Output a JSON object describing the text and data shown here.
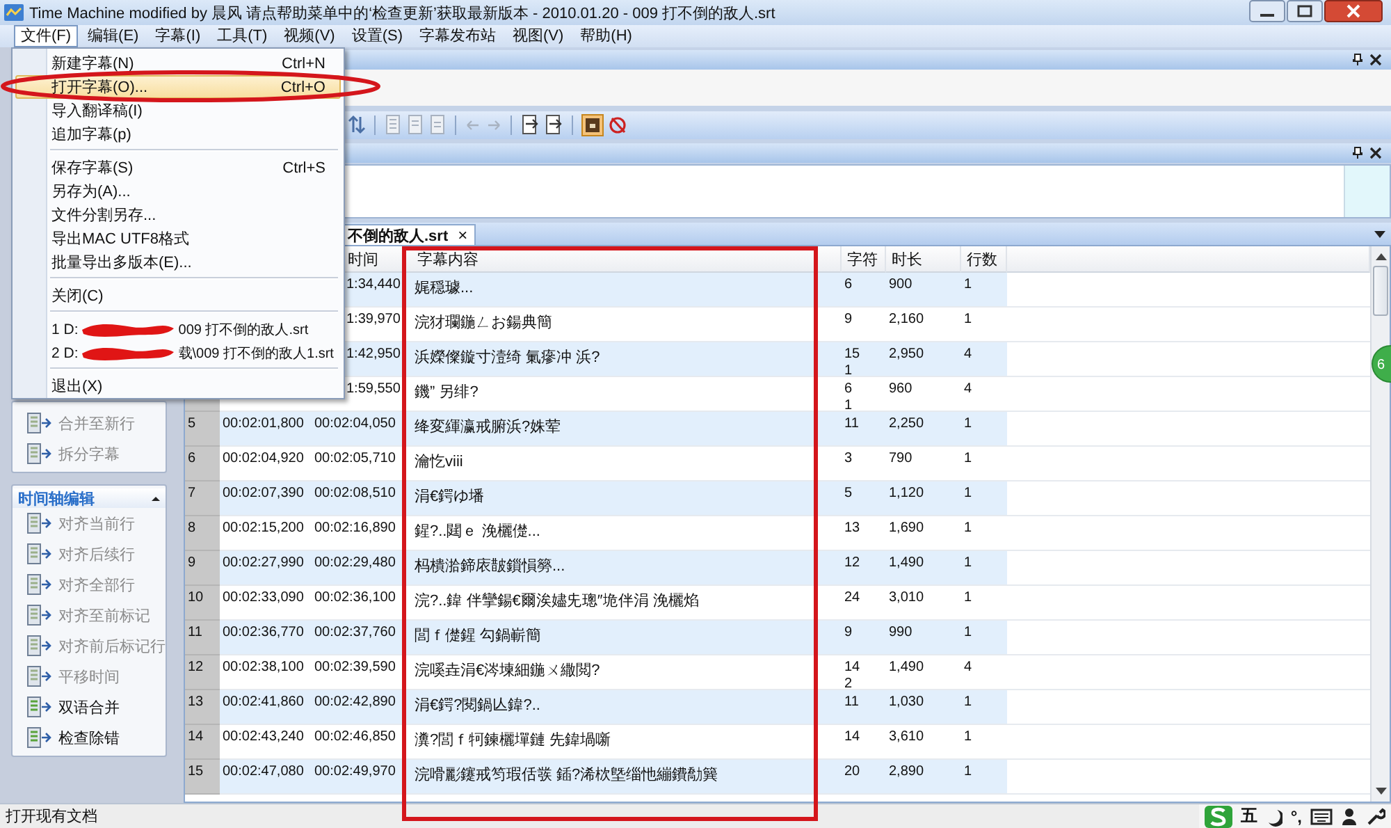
{
  "window": {
    "title": "Time Machine modified by 晨风 请点帮助菜单中的‘检查更新’获取最新版本 - 2010.01.20 - 009 打不倒的敌人.srt"
  },
  "menu_bar": [
    {
      "label": "文件(F)",
      "selected": true
    },
    {
      "label": "编辑(E)",
      "selected": false
    },
    {
      "label": "字幕(I)",
      "selected": false
    },
    {
      "label": "工具(T)",
      "selected": false
    },
    {
      "label": "视频(V)",
      "selected": false
    },
    {
      "label": "设置(S)",
      "selected": false
    },
    {
      "label": "字幕发布站",
      "selected": false
    },
    {
      "label": "视图(V)",
      "selected": false
    },
    {
      "label": "帮助(H)",
      "selected": false
    }
  ],
  "file_menu": [
    {
      "kind": "item",
      "label": "新建字幕(N)",
      "shortcut": "Ctrl+N",
      "selected": false
    },
    {
      "kind": "item",
      "label": "打开字幕(O)...",
      "shortcut": "Ctrl+O",
      "selected": true,
      "circled": true
    },
    {
      "kind": "item",
      "label": "导入翻译稿(I)",
      "selected": false
    },
    {
      "kind": "item",
      "label": "追加字幕(p)",
      "selected": false
    },
    {
      "kind": "separator"
    },
    {
      "kind": "item",
      "label": "保存字幕(S)",
      "shortcut": "Ctrl+S",
      "selected": false
    },
    {
      "kind": "item",
      "label": "另存为(A)...",
      "selected": false
    },
    {
      "kind": "item",
      "label": "文件分割另存...",
      "selected": false
    },
    {
      "kind": "item",
      "label": "导出MAC UTF8格式",
      "selected": false
    },
    {
      "kind": "item",
      "label": "批量导出多版本(E)...",
      "selected": false
    },
    {
      "kind": "separator"
    },
    {
      "kind": "item",
      "label": "关闭(C)",
      "selected": false
    },
    {
      "kind": "separator"
    },
    {
      "kind": "recent",
      "prefix": "1 D:",
      "suffix": "009 打不倒的敌人.srt",
      "selected": false
    },
    {
      "kind": "recent",
      "prefix": "2 D:",
      "suffix": "载\\009 打不倒的敌人1.srt",
      "selected": false
    },
    {
      "kind": "separator"
    },
    {
      "kind": "item",
      "label": "退出(X)",
      "selected": false
    }
  ],
  "sidebar": {
    "panels": [
      {
        "items": [
          {
            "label": "合并至新行",
            "disabled": true
          },
          {
            "label": "拆分字幕",
            "disabled": true
          }
        ]
      },
      {
        "title": "时间轴编辑",
        "expanded": true,
        "items": [
          {
            "label": "对齐当前行",
            "disabled": true
          },
          {
            "label": "对齐后续行",
            "disabled": true
          },
          {
            "label": "对齐全部行",
            "disabled": true
          },
          {
            "label": "对齐至前标记",
            "disabled": true
          },
          {
            "label": "对齐前后标记行",
            "disabled": true
          },
          {
            "label": "平移时间",
            "disabled": true
          },
          {
            "label": "双语合并",
            "disabled": false
          },
          {
            "label": "检查除错",
            "disabled": false
          }
        ]
      }
    ]
  },
  "document_tab": {
    "label": "不倒的敌人.srt",
    "close": "×"
  },
  "table": {
    "content_boxed": true,
    "columns": {
      "end": "时间",
      "content": "字幕内容",
      "chars": "字符",
      "duration": "时长",
      "lines": "行数"
    },
    "rows": [
      {
        "end": "1:34,440",
        "content": "娓穏璩...",
        "chars": [
          "6"
        ],
        "duration": "900",
        "lines": "1"
      },
      {
        "end": "1:39,970",
        "content": "浣犲瓓鍦ㄥお鍚典簡",
        "chars": [
          "9"
        ],
        "duration": "2,160",
        "lines": "1"
      },
      {
        "end": "1:42,950",
        "content": "浜嬫儏鏇寸潱绮   氭瘮冲   浜?",
        "chars": [
          "15",
          "1"
        ],
        "duration": "2,950",
        "lines": "4"
      },
      {
        "end": "1:59,550",
        "content": "鐖” 另绯?",
        "chars": [
          "6",
          "1"
        ],
        "duration": "960",
        "lines": "4"
      },
      {
        "number": "5",
        "start": "00:02:01,800",
        "end": "00:02:04,050",
        "content": "绛変緷瀛戒腑浜?姝荤",
        "chars": [
          "11"
        ],
        "duration": "2,250",
        "lines": "1"
      },
      {
        "number": "6",
        "start": "00:02:04,920",
        "end": "00:02:05,710",
        "content": "瀹忔viii",
        "chars": [
          "3"
        ],
        "duration": "790",
        "lines": "1"
      },
      {
        "number": "7",
        "start": "00:02:07,390",
        "end": "00:02:08,510",
        "content": "涓€鍔ゆ墦",
        "chars": [
          "5"
        ],
        "duration": "1,120",
        "lines": "1"
      },
      {
        "number": "8",
        "start": "00:02:15,200",
        "end": "00:02:16,890",
        "content": "鍟?..閮ｅ   浼欐儊...",
        "chars": [
          "13"
        ],
        "duration": "1,690",
        "lines": "1"
      },
      {
        "number": "9",
        "start": "00:02:27,990",
        "end": "00:02:29,480",
        "content": "杩樻湁鍗庡皵鎻愪簩...",
        "chars": [
          "12"
        ],
        "duration": "1,490",
        "lines": "1"
      },
      {
        "number": "10",
        "start": "00:02:33,090",
        "end": "00:02:36,100",
        "content": "浣?..鍏   伴攣鍚€爾涘嬧兂璁″垝伴涓     浼欐焰",
        "chars": [
          "24"
        ],
        "duration": "3,010",
        "lines": "1"
      },
      {
        "number": "11",
        "start": "00:02:36,770",
        "end": "00:02:37,760",
        "content": "閭ｆ儊鍟   勾鍋嶄簡",
        "chars": [
          "9"
        ],
        "duration": "990",
        "lines": "1"
      },
      {
        "number": "12",
        "start": "00:02:38,100",
        "end": "00:02:39,590",
        "content": "浣嗘垚涓€涔堜細鍦ㄨ繖閲?",
        "chars": [
          "14",
          "2"
        ],
        "duration": "1,490",
        "lines": "4"
      },
      {
        "number": "13",
        "start": "00:02:41,860",
        "end": "00:02:42,890",
        "content": "涓€鍔?閱鍋亾鍏?..",
        "chars": [
          "11"
        ],
        "duration": "1,030",
        "lines": "1"
      },
      {
        "number": "14",
        "start": "00:02:43,240",
        "end": "00:02:46,850",
        "content": "瀵?閭ｆ牱鍊欐墠鏈   先鍏堝噺",
        "chars": [
          "14"
        ],
        "duration": "3,610",
        "lines": "1"
      },
      {
        "number": "15",
        "start": "00:02:47,080",
        "end": "00:02:49,970",
        "content": "浣嗗彲鑳戒笉瑕佸彂   鍤?浠栨墍缁忚繃鐨勪簨",
        "chars": [
          "20"
        ],
        "duration": "2,890",
        "lines": "1"
      }
    ]
  },
  "status_bar": {
    "text": "打开现有文档",
    "ime": [
      "五",
      "°,"
    ]
  },
  "floating_badge": {
    "text": "6"
  }
}
